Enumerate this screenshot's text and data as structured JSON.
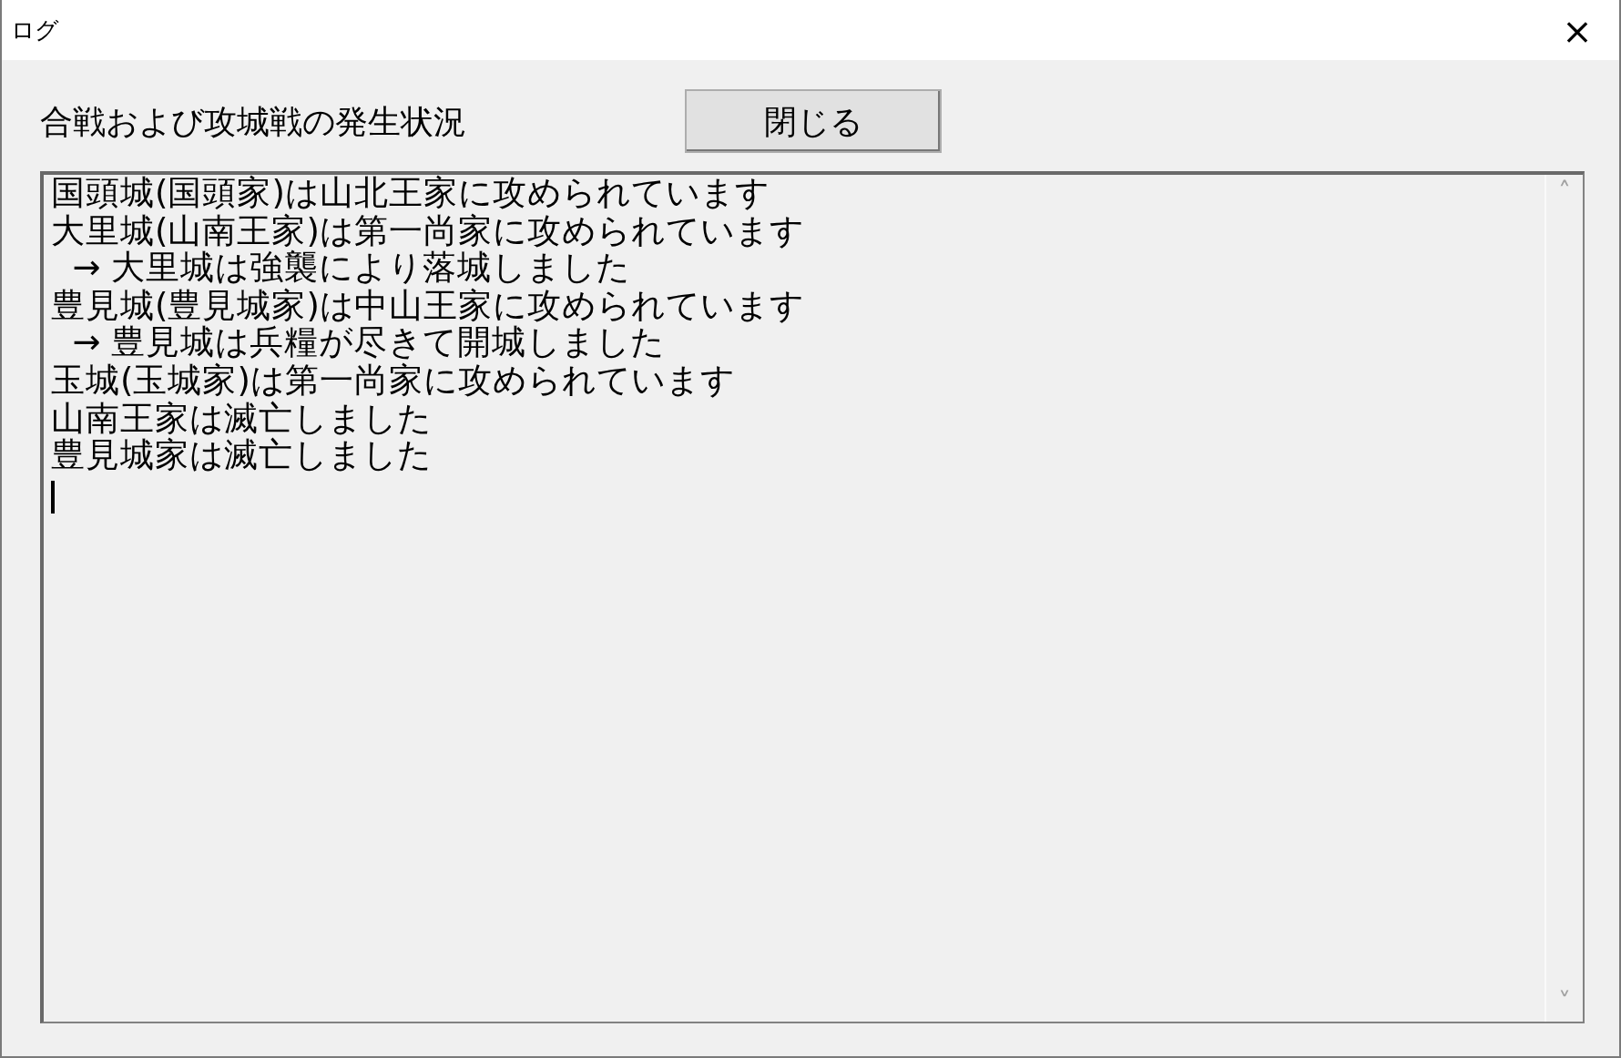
{
  "window": {
    "title": "ログ",
    "close": "×"
  },
  "header": {
    "label": "合戦および攻城戦の発生状況",
    "close_button": "閉じる"
  },
  "log": {
    "lines": [
      "国頭城(国頭家)は山北王家に攻められています",
      "大里城(山南王家)は第一尚家に攻められています",
      "  → 大里城は強襲により落城しました",
      "豊見城(豊見城家)は中山王家に攻められています",
      "  → 豊見城は兵糧が尽きて開城しました",
      "玉城(玉城家)は第一尚家に攻められています",
      "山南王家は滅亡しました",
      "豊見城家は滅亡しました"
    ],
    "scroll_up": "˄",
    "scroll_down": "˅"
  }
}
